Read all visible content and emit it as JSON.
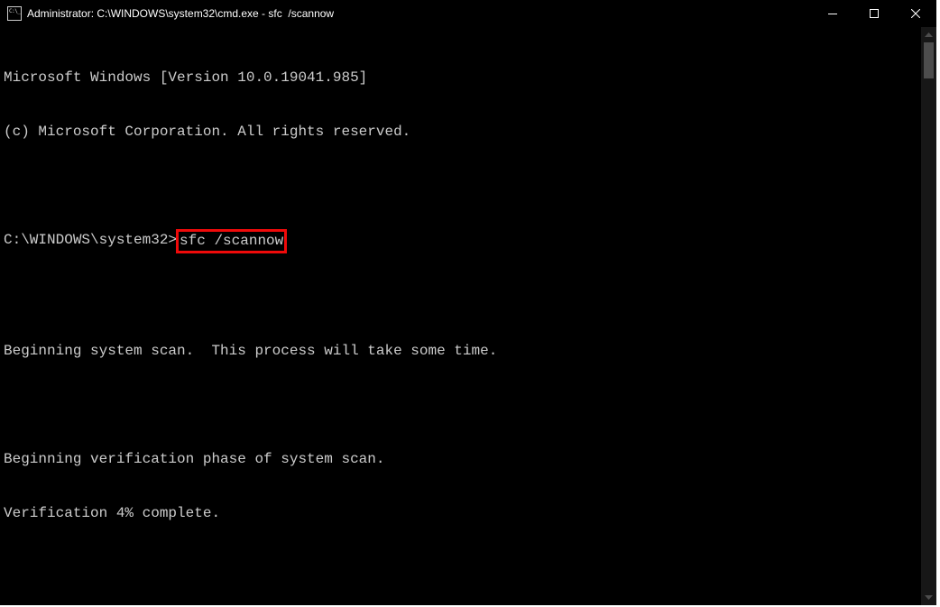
{
  "window": {
    "title": "Administrator: C:\\WINDOWS\\system32\\cmd.exe - sfc  /scannow"
  },
  "terminal": {
    "line_version": "Microsoft Windows [Version 10.0.19041.985]",
    "line_copyright": "(c) Microsoft Corporation. All rights reserved.",
    "prompt_path": "C:\\WINDOWS\\system32>",
    "command_typed": "sfc /scannow",
    "line_beginning_scan": "Beginning system scan.  This process will take some time.",
    "line_verification_phase": "Beginning verification phase of system scan.",
    "line_verification_progress": "Verification 4% complete."
  }
}
